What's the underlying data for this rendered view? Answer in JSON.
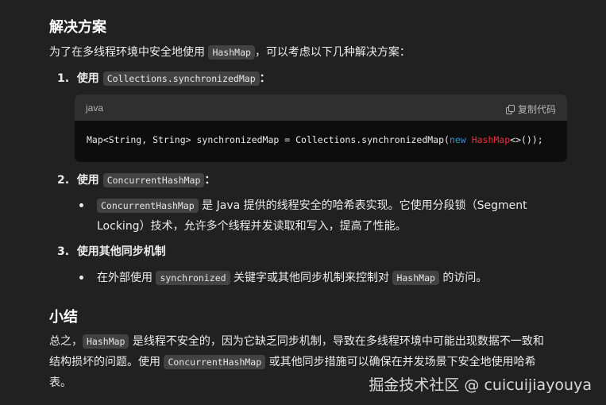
{
  "section1": {
    "heading": "解决方案",
    "intro_before": "为了在多线程环境中安全地使用",
    "intro_code": "HashMap",
    "intro_after": "，可以考虑以下几种解决方案："
  },
  "item1": {
    "num": "1.",
    "label": "使用",
    "code": "Collections.synchronizedMap",
    "suffix": "："
  },
  "code_block": {
    "language": "java",
    "copy_label": "复制代码",
    "code_part1": "Map<String, String> synchronizedMap = Collections.synchronizedMap(",
    "kw_new": "new",
    "cls_hashmap": "HashMap",
    "code_part2": "<>());"
  },
  "item2": {
    "num": "2.",
    "label": "使用",
    "code": "ConcurrentHashMap",
    "suffix": "：",
    "bullet_code": "ConcurrentHashMap",
    "bullet_line1": "是 Java 提供的线程安全的哈希表实现。它使用分段锁（Segment",
    "bullet_line2": "Locking）技术，允许多个线程并发读取和写入，提高了性能。"
  },
  "item3": {
    "num": "3.",
    "label": "使用其他同步机制",
    "bullet_before": "在外部使用",
    "bullet_code1": "synchronized",
    "bullet_mid": "关键字或其他同步机制来控制对",
    "bullet_code2": "HashMap",
    "bullet_after": "的访问。"
  },
  "summary": {
    "heading": "小结",
    "line1_before": "总之，",
    "line1_code": "HashMap",
    "line1_after": "是线程不安全的，因为它缺乏同步机制，导致在多线程环境中可能出现数据不一致和",
    "line2_before": "结构损坏的问题。使用",
    "line2_code": "ConcurrentHashMap",
    "line2_after": "或其他同步措施可以确保在并发场景下安全地使用哈希",
    "line3": "表。"
  },
  "watermark": "掘金技术社区 @ cuicuijiayouya"
}
